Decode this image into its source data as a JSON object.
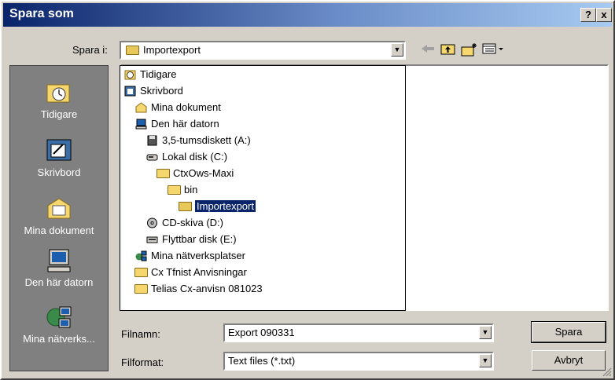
{
  "window": {
    "title": "Spara som",
    "help_label": "?",
    "close_label": "x"
  },
  "lookin": {
    "label": "Spara i:",
    "value": "Importexport"
  },
  "toolbar": {
    "back_icon": "back-arrow-icon",
    "up_icon": "up-folder-icon",
    "new_folder_icon": "new-folder-icon",
    "views_icon": "views-menu-icon"
  },
  "places": [
    {
      "label": "Tidigare",
      "icon": "history-icon"
    },
    {
      "label": "Skrivbord",
      "icon": "desktop-icon"
    },
    {
      "label": "Mina dokument",
      "icon": "my-documents-icon"
    },
    {
      "label": "Den här datorn",
      "icon": "my-computer-icon"
    },
    {
      "label": "Mina nätverks...",
      "icon": "network-places-icon"
    }
  ],
  "dropdown_items": [
    {
      "label": "Tidigare",
      "icon": "history-icon"
    },
    {
      "label": "Skrivbord",
      "icon": "desktop-icon"
    },
    {
      "label": "Mina dokument",
      "icon": "my-documents-icon"
    },
    {
      "label": "Den här datorn",
      "icon": "my-computer-icon"
    },
    {
      "label": "3,5-tumsdiskett (A:)",
      "icon": "floppy-icon"
    },
    {
      "label": "Lokal disk (C:)",
      "icon": "hard-disk-icon"
    },
    {
      "label": "CtxOws-Maxi",
      "icon": "folder-icon"
    },
    {
      "label": "bin",
      "icon": "folder-icon"
    },
    {
      "label": "Importexport",
      "icon": "open-folder-icon",
      "selected": true
    },
    {
      "label": "CD-skiva (D:)",
      "icon": "cd-drive-icon"
    },
    {
      "label": "Flyttbar disk (E:)",
      "icon": "removable-disk-icon"
    },
    {
      "label": "Mina nätverksplatser",
      "icon": "network-places-icon"
    },
    {
      "label": "Cx Tfnist Anvisningar",
      "icon": "folder-icon"
    },
    {
      "label": "Telias Cx-anvisn 081023",
      "icon": "folder-icon"
    }
  ],
  "filename": {
    "label": "Filnamn:",
    "value": "Export 090331"
  },
  "filetype": {
    "label": "Filformat:",
    "value": "Text files (*.txt)"
  },
  "buttons": {
    "save": "Spara",
    "cancel": "Avbryt"
  },
  "colors": {
    "title_bar": "#0a246a",
    "dialog_bg": "#d4d0c8",
    "places_bar": "#808080",
    "selection": "#0a246a"
  }
}
